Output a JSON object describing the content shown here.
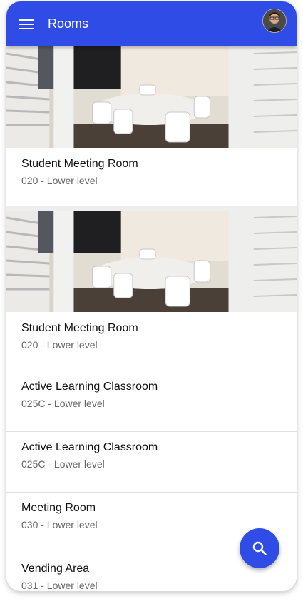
{
  "app": {
    "title": "Rooms"
  },
  "icons": {
    "menu": "menu-icon",
    "avatar": "user-avatar",
    "fab": "search-icon"
  },
  "colors": {
    "primary": "#2f4de6",
    "text": "#111111",
    "secondary_text": "#666666"
  },
  "rooms": [
    {
      "name": "Student Meeting Room",
      "location": "020 - Lower level",
      "has_image": true
    },
    {
      "name": "Student Meeting Room",
      "location": "020 - Lower level",
      "has_image": true
    },
    {
      "name": "Active Learning Classroom",
      "location": "025C - Lower level",
      "has_image": false
    },
    {
      "name": "Active Learning Classroom",
      "location": "025C - Lower level",
      "has_image": false
    },
    {
      "name": "Meeting Room",
      "location": "030 - Lower level",
      "has_image": false
    },
    {
      "name": "Vending Area",
      "location": "031 - Lower level",
      "has_image": false
    }
  ]
}
